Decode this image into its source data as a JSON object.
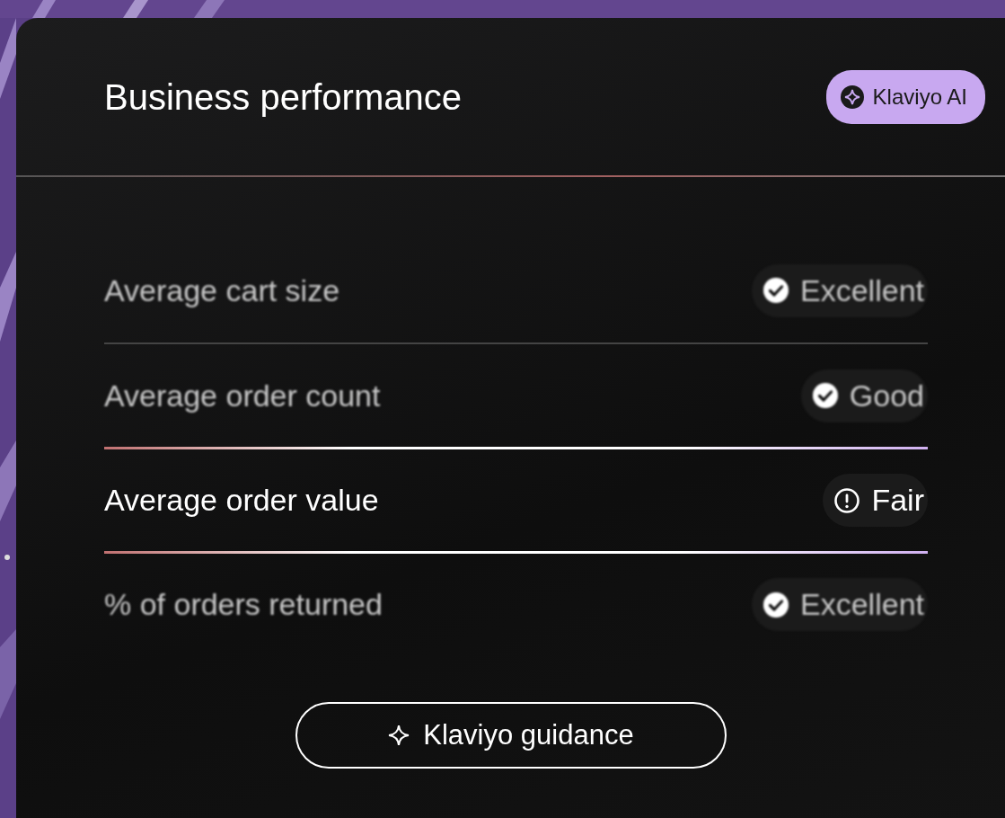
{
  "card": {
    "title": "Business performance",
    "badge": "Klaviyo AI"
  },
  "metrics": [
    {
      "label": "Average cart size",
      "status": "Excellent",
      "kind": "check",
      "blurred": true
    },
    {
      "label": "Average order count",
      "status": "Good",
      "kind": "check",
      "blurred": true
    },
    {
      "label": "Average order value",
      "status": "Fair",
      "kind": "warning",
      "blurred": false
    },
    {
      "label": "% of orders returned",
      "status": "Excellent",
      "kind": "check",
      "blurred": true
    }
  ],
  "button": {
    "label": "Klaviyo guidance"
  }
}
